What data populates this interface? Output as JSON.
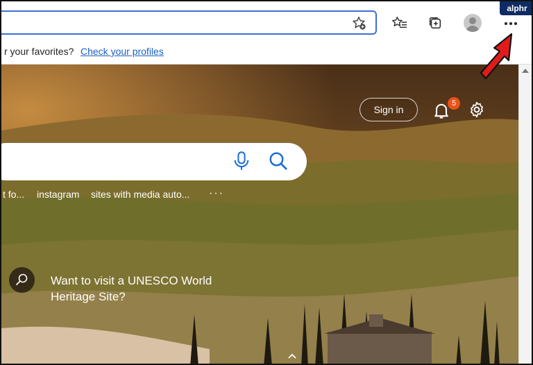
{
  "watermark": "alphr",
  "toolbar": {
    "address_value": "",
    "favorite_icon": "star-plus-icon",
    "favorites_icon": "favorites-list-icon",
    "collections_icon": "collections-icon",
    "profile_icon": "avatar-icon",
    "more_icon": "more-horizontal-icon"
  },
  "favorites_bar": {
    "message": "r your favorites?",
    "link": "Check your profiles"
  },
  "newtab": {
    "sign_in": "Sign in",
    "notification_count": "5",
    "quick_links": [
      "t fo...",
      "instagram",
      "sites with media auto..."
    ],
    "more_links": "···",
    "fact_text": "Want to visit a UNESCO World Heritage Site?"
  },
  "colors": {
    "accent": "#3b6fd6",
    "link": "#1a5fc2",
    "badge": "#e8531a",
    "arrow": "#e11b1b"
  }
}
